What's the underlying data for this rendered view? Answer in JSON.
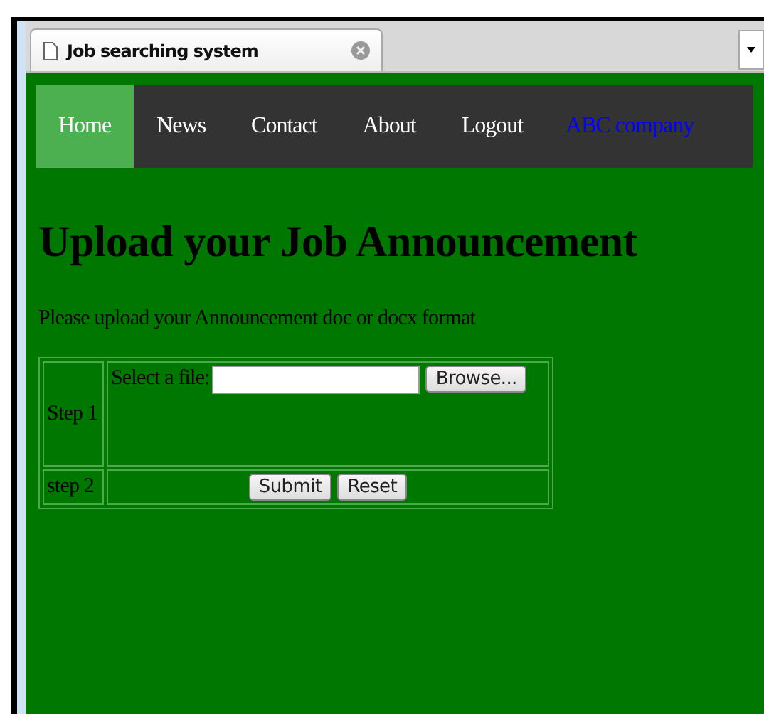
{
  "browser_tab": {
    "title": "Job searching system"
  },
  "nav": {
    "items": [
      {
        "label": "Home",
        "selected": true
      },
      {
        "label": "News",
        "selected": false
      },
      {
        "label": "Contact",
        "selected": false
      },
      {
        "label": "About",
        "selected": false
      },
      {
        "label": "Logout",
        "selected": false
      }
    ],
    "company": "ABC company"
  },
  "heading": "Upload your Job Announcement",
  "intro": "Please upload your Announcement doc or docx format",
  "form": {
    "step1": {
      "label": "Step 1",
      "field_label": "Select a file:",
      "browse": "Browse..."
    },
    "step2": {
      "label": "step 2",
      "buttons": [
        "Submit",
        "Reset"
      ]
    }
  }
}
